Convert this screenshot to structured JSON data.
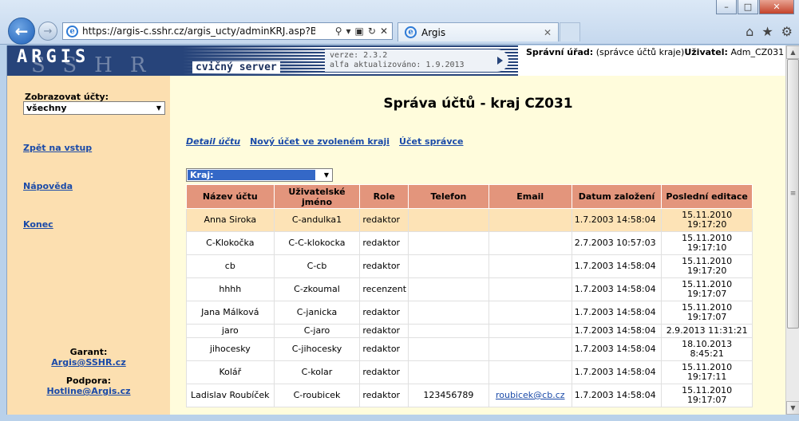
{
  "browser": {
    "url": "https://argis-c.sshr.cz/argis_ucty/adminKRJ.asp?BACKO",
    "tab_title": "Argis",
    "ie_glyph": "e",
    "window_controls": [
      "–",
      "□",
      "✕"
    ],
    "icons": [
      "back-arrow-icon",
      "forward-arrow-icon",
      "search-icon",
      "dropdown-icon",
      "lock-icon",
      "refresh-icon",
      "stop-icon",
      "home-icon",
      "favorites-star-icon",
      "tools-gear-icon"
    ]
  },
  "header": {
    "logo": "ARGIS",
    "logo_ghost": "SSHR",
    "subtitle": "cvičný server",
    "version": "verze: 2.3.2",
    "updated": "alfa aktualizováno: 1.9.2013",
    "office_label": "Správní úřad:",
    "office_value": "(správce účtů kraje)",
    "user_label": "Uživatel:",
    "user_value": "Adm_CZ031"
  },
  "sidebar": {
    "filter_label": "Zobrazovat účty:",
    "filter_value": "všechny",
    "links": {
      "back": "Zpět na vstup",
      "help": "Nápověda",
      "end": "Konec"
    },
    "guarantor_label": "Garant:",
    "guarantor_email": "Argis@SSHR.cz",
    "support_label": "Podpora:",
    "support_email": "Hotline@Argis.cz"
  },
  "main": {
    "title": "Správa účtů - kraj CZ031",
    "actions": {
      "detail": "Detail účtu",
      "new": "Nový účet ve zvoleném kraji",
      "admin": "Účet správce"
    },
    "region_select": "Kraj:",
    "columns": {
      "name": "Název účtu",
      "username": "Uživatelské jméno",
      "role": "Role",
      "phone": "Telefon",
      "email": "Email",
      "created": "Datum založení",
      "edited": "Poslední editace"
    },
    "rows": [
      {
        "name": "Anna Siroka",
        "username": "C-andulka1",
        "role": "redaktor",
        "phone": "",
        "email": "",
        "created": "1.7.2003 14:58:04",
        "edited_date": "15.11.2010",
        "edited_time": "19:17:20"
      },
      {
        "name": "C-Klokočka",
        "username": "C-C-klokocka",
        "role": "redaktor",
        "phone": "",
        "email": "",
        "created": "2.7.2003 10:57:03",
        "edited_date": "15.11.2010",
        "edited_time": "19:17:10"
      },
      {
        "name": "cb",
        "username": "C-cb",
        "role": "redaktor",
        "phone": "",
        "email": "",
        "created": "1.7.2003 14:58:04",
        "edited_date": "15.11.2010",
        "edited_time": "19:17:20"
      },
      {
        "name": "hhhh",
        "username": "C-zkoumal",
        "role": "recenzent",
        "phone": "",
        "email": "",
        "created": "1.7.2003 14:58:04",
        "edited_date": "15.11.2010",
        "edited_time": "19:17:07"
      },
      {
        "name": "Jana Málková",
        "username": "C-janicka",
        "role": "redaktor",
        "phone": "",
        "email": "",
        "created": "1.7.2003 14:58:04",
        "edited_date": "15.11.2010",
        "edited_time": "19:17:07"
      },
      {
        "name": "jaro",
        "username": "C-jaro",
        "role": "redaktor",
        "phone": "",
        "email": "",
        "created": "1.7.2003 14:58:04",
        "edited_date": "2.9.2013 11:31:21",
        "edited_time": ""
      },
      {
        "name": "jihocesky",
        "username": "C-jihocesky",
        "role": "redaktor",
        "phone": "",
        "email": "",
        "created": "1.7.2003 14:58:04",
        "edited_date": "18.10.2013",
        "edited_time": "8:45:21"
      },
      {
        "name": "Kolář",
        "username": "C-kolar",
        "role": "redaktor",
        "phone": "",
        "email": "",
        "created": "1.7.2003 14:58:04",
        "edited_date": "15.11.2010",
        "edited_time": "19:17:11"
      },
      {
        "name": "Ladislav Roubíček",
        "username": "C-roubicek",
        "role": "redaktor",
        "phone": "123456789",
        "email": "roubicek@cb.cz",
        "created": "1.7.2003 14:58:04",
        "edited_date": "15.11.2010",
        "edited_time": "19:17:07"
      }
    ]
  }
}
